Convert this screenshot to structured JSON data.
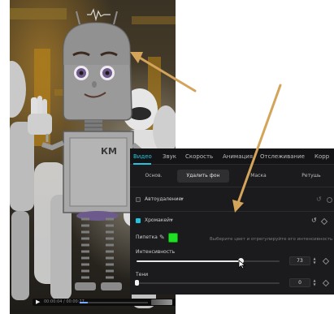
{
  "video_player": {
    "play_icon": "play-icon",
    "time_text": "00:00:04 / 00:00:27",
    "progress": 0.12
  },
  "editor": {
    "tabs": [
      {
        "label": "Видео",
        "active": true
      },
      {
        "label": "Звук",
        "active": false
      },
      {
        "label": "Скорость",
        "active": false
      },
      {
        "label": "Анимация",
        "active": false
      },
      {
        "label": "Отслеживание",
        "active": false
      },
      {
        "label": "Корр",
        "active": false
      }
    ],
    "subtabs": [
      {
        "label": "Основ.",
        "active": false
      },
      {
        "label": "Удалить фон",
        "active": true
      },
      {
        "label": "Маска",
        "active": false
      },
      {
        "label": "Ретушь",
        "active": false
      }
    ],
    "auto_remove": {
      "label": "Автоудаление",
      "checked": false
    },
    "chroma_key": {
      "label": "Хромакей",
      "checked": true,
      "reset_icon": "reset-icon"
    },
    "eyedropper": {
      "label": "Пипетка",
      "icon": "eyedropper-icon",
      "color": "#1fe024",
      "hint": "Выберите цвет и отрегулируйте его интенсивность"
    },
    "intensity": {
      "label": "Интенсивность",
      "value": "73",
      "fraction": 0.73
    },
    "shadows": {
      "label": "Тени",
      "value": "0",
      "fraction": 0.0
    }
  },
  "colors": {
    "accent": "#25c4dc",
    "panel_bg": "#1b1b1d",
    "arrow": "#d4a45a"
  }
}
